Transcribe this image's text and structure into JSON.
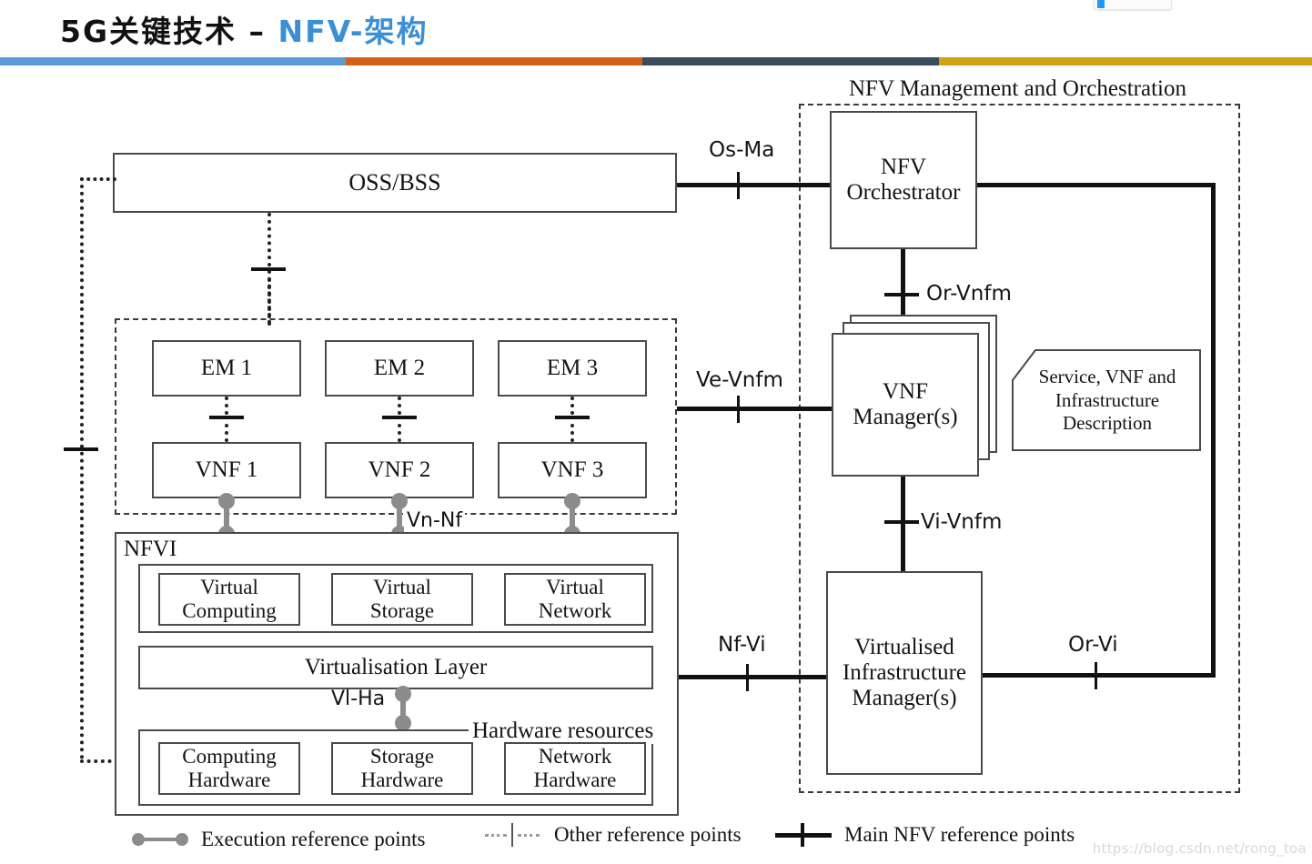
{
  "slide": {
    "title_main": "5G关键技术  –  ",
    "title_accent": "NFV-架构",
    "rule_colors": [
      "#5b9bd5",
      "#d2601a",
      "#3c4c5c",
      "#d1a211"
    ]
  },
  "diagram": {
    "mano_caption": "NFV Management and Orchestration",
    "oss_bss": "OSS/BSS",
    "nfvi_label": "NFVI",
    "hardware_resources_label": "Hardware resources",
    "virtualisation_layer": "Virtualisation Layer",
    "em": [
      "EM 1",
      "EM 2",
      "EM 3"
    ],
    "vnf": [
      "VNF 1",
      "VNF 2",
      "VNF 3"
    ],
    "virtual_resources": [
      "Virtual\nComputing",
      "Virtual\nStorage",
      "Virtual\nNetwork"
    ],
    "virtual_resources_lines": [
      [
        "Virtual",
        "Computing"
      ],
      [
        "Virtual",
        "Storage"
      ],
      [
        "Virtual",
        "Network"
      ]
    ],
    "hardware_lines": [
      [
        "Computing",
        "Hardware"
      ],
      [
        "Storage",
        "Hardware"
      ],
      [
        "Network",
        "Hardware"
      ]
    ],
    "nfv_orchestrator": [
      "NFV",
      "Orchestrator"
    ],
    "vnf_manager": [
      "VNF",
      "Manager(s)"
    ],
    "vim": [
      "Virtualised",
      "Infrastructure",
      "Manager(s)"
    ],
    "description_box": [
      "Service, VNF and",
      "Infrastructure",
      "Description"
    ],
    "reference_points": {
      "os_ma": "Os-Ma",
      "ve_vnfm": "Ve-Vnfm",
      "nf_vi": "Nf-Vi",
      "or_vnfm": "Or-Vnfm",
      "vi_vnfm": "Vi-Vnfm",
      "or_vi": "Or-Vi",
      "vn_nf": "Vn-Nf",
      "vl_ha": "Vl-Ha"
    }
  },
  "legend": {
    "execution": "Execution reference points",
    "other": "Other reference points",
    "main": "Main NFV reference points"
  },
  "watermark": "https://blog.csdn.net/rong_toa"
}
